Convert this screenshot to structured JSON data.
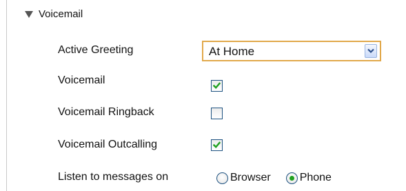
{
  "section": {
    "title": "Voicemail",
    "expanded": true
  },
  "fields": {
    "active_greeting": {
      "label": "Active Greeting",
      "value": "At Home"
    },
    "voicemail": {
      "label": "Voicemail",
      "checked": true
    },
    "voicemail_ringback": {
      "label": "Voicemail Ringback",
      "checked": false
    },
    "voicemail_outcalling": {
      "label": "Voicemail Outcalling",
      "checked": true
    },
    "listen_to_messages_on": {
      "label": "Listen to messages on",
      "options": [
        {
          "label": "Browser",
          "selected": false
        },
        {
          "label": "Phone",
          "selected": true
        }
      ]
    }
  },
  "colors": {
    "check": "#21a121",
    "focus_border": "#e1a84a",
    "control_border": "#1c5180"
  },
  "icons": {
    "section_toggle": "triangle-down-icon",
    "dropdown": "chevron-down-icon",
    "checkmark": "checkmark-icon"
  }
}
